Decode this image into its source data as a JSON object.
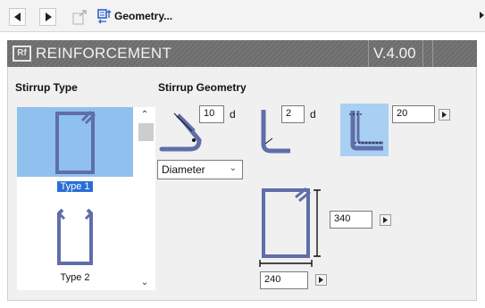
{
  "toolbar": {
    "title": "Geometry...",
    "icons": [
      "back-icon",
      "forward-icon",
      "export-icon",
      "geometry-icon"
    ]
  },
  "banner": {
    "logo_text": "Rf",
    "title": "REINFORCEMENT",
    "version": "V.4.00"
  },
  "stirrup_type": {
    "heading": "Stirrup Type",
    "items": [
      {
        "label": "Type 1",
        "selected": true
      },
      {
        "label": "Type 2",
        "selected": false
      }
    ]
  },
  "stirrup_geometry": {
    "heading": "Stirrup Geometry",
    "hook_length": {
      "value": "10",
      "unit": "d"
    },
    "bend_radius": {
      "value": "2",
      "unit": "d"
    },
    "hook_offset": {
      "value": "20"
    },
    "dimension_mode": {
      "selected": "Diameter"
    },
    "height": {
      "value": "340"
    },
    "width": {
      "value": "240"
    }
  },
  "colors": {
    "bar": "#5f6ea8",
    "selection": "#8fc0ee",
    "banner": "#6f6f6f"
  }
}
